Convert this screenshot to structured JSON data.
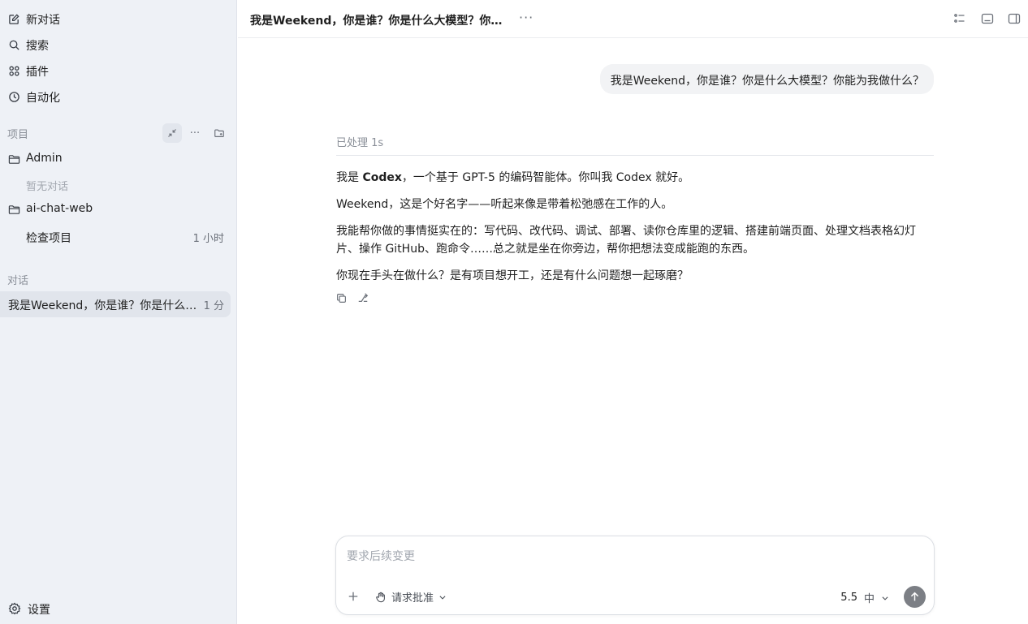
{
  "sidebar": {
    "nav": [
      {
        "label": "新对话",
        "icon": "edit-icon"
      },
      {
        "label": "搜索",
        "icon": "search-icon"
      },
      {
        "label": "插件",
        "icon": "plugins-icon"
      },
      {
        "label": "自动化",
        "icon": "clock-icon"
      }
    ],
    "projects_label": "项目",
    "projects": [
      {
        "name": "Admin",
        "empty_note": "暂无对话"
      },
      {
        "name": "ai-chat-web",
        "threads": [
          {
            "title": "检查项目",
            "time": "1 小时"
          }
        ]
      }
    ],
    "conversations_label": "对话",
    "conversations": [
      {
        "title": "我是Weekend，你是谁？你是什么大模型？你能为我做什么？",
        "time": "1 分"
      }
    ],
    "settings_label": "设置"
  },
  "header": {
    "title": "我是Weekend，你是谁？你是什么大模型？你能为我做什么？",
    "more": "···"
  },
  "chat": {
    "user_message": "我是Weekend，你是谁？你是什么大模型？你能为我做什么？",
    "processed_label": "已处理 1s",
    "assistant": {
      "p1_prefix": "我是 ",
      "p1_bold": "Codex",
      "p1_suffix": "，一个基于 GPT-5 的编码智能体。你叫我 Codex 就好。",
      "p2": "Weekend，这是个好名字——听起来像是带着松弛感在工作的人。",
      "p3": "我能帮你做的事情挺实在的：写代码、改代码、调试、部署、读你仓库里的逻辑、搭建前端页面、处理文档表格幻灯片、操作 GitHub、跑命令……总之就是坐在你旁边，帮你把想法变成能跑的东西。",
      "p4": "你现在手头在做什么？是有项目想开工，还是有什么问题想一起琢磨？"
    }
  },
  "composer": {
    "placeholder": "要求后续变更",
    "approval_label": "请求批准",
    "model": "5.5",
    "level": "中"
  },
  "colors": {
    "sidebar_bg": "#eef1f6",
    "active_row": "#e1e5ec",
    "bubble_bg": "#f2f3f5",
    "send_button": "#7c7f85"
  }
}
